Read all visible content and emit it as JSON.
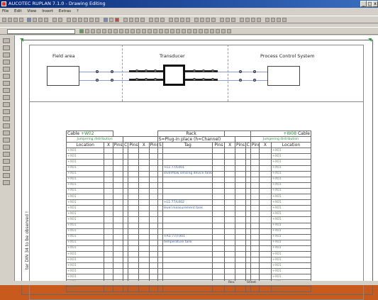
{
  "window": {
    "title": "AUCOTEC RUPLAN 7.1.0 - Drawing Editing",
    "title_color": "#0a2a7a"
  },
  "menu": [
    "File",
    "Edit",
    "View",
    "Insert",
    "Extras",
    "?"
  ],
  "controls": {
    "minimize": "_",
    "maximize": "□",
    "close": "x"
  },
  "diagram": {
    "field_area": "Field area",
    "transducer": "Transducer",
    "pcs": "Process Control System"
  },
  "terminal_table": {
    "cable_left": "Cable",
    "cable_left_id": "+W02",
    "rack_title": "Rack",
    "cable_right_id": "+W08",
    "cable_right": "Cable",
    "jumper_left": "Jumpering distribution",
    "rack_subtitle": "S=Plug-in place (h=Channel)",
    "jumper_right": "Jumpering distribution",
    "col_headers_left": [
      "Location",
      "X",
      "Pins",
      "C",
      "Pins",
      "X",
      "Pins",
      "S"
    ],
    "col_tag": "Tag",
    "col_headers_right": [
      "Pins",
      "X",
      "Pins",
      "C",
      "Pins",
      "X",
      "Location"
    ],
    "tags": [
      {
        "id": "+L1:77/L001",
        "desc": "level/flow sensing device tank"
      },
      {
        "id": "+L1:77/L002",
        "desc": "level measurement tank"
      },
      {
        "id": "+A1:77/T001",
        "desc": "temperature tank"
      }
    ],
    "location_code_left": "+X01",
    "location_code_right": "+X01"
  },
  "side_note": "ter DIN 34 to be observed !",
  "status": {
    "left": "Rev.",
    "mid": "Sheet"
  }
}
